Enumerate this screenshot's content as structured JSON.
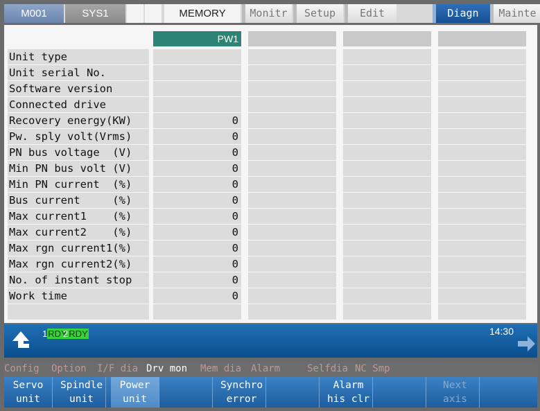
{
  "topbar": {
    "part_system": "M001",
    "system": "SYS1",
    "mode": "MEMORY",
    "tabs": [
      "Monitr",
      "Setup",
      "Edit",
      "Diagn",
      "Mainte"
    ],
    "active_tab": "Diagn"
  },
  "table": {
    "column_header": "PW1",
    "rows": [
      {
        "label": "Unit type",
        "value": ""
      },
      {
        "label": "Unit serial No.",
        "value": ""
      },
      {
        "label": "Software version",
        "value": ""
      },
      {
        "label": "Connected drive",
        "value": ""
      },
      {
        "label": "Recovery energy(KW)",
        "value": "0"
      },
      {
        "label": "Pw. sply volt(Vrms)",
        "value": "0"
      },
      {
        "label": "PN bus voltage  (V)",
        "value": "0"
      },
      {
        "label": "Min PN bus volt (V)",
        "value": "0"
      },
      {
        "label": "Min PN current  (%)",
        "value": "0"
      },
      {
        "label": "Bus current     (%)",
        "value": "0"
      },
      {
        "label": "Max current1    (%)",
        "value": "0"
      },
      {
        "label": "Max current2    (%)",
        "value": "0"
      },
      {
        "label": "Max rgn current1(%)",
        "value": "0"
      },
      {
        "label": "Max rgn current2(%)",
        "value": "0"
      },
      {
        "label": "No. of instant stop",
        "value": "0"
      },
      {
        "label": "Work time",
        "value": "0"
      },
      {
        "label": "",
        "value": ""
      }
    ]
  },
  "status": {
    "sys1_num": "1",
    "sys1_state": "RDY",
    "sys2_num": "2",
    "sys2_state": "RDY",
    "time": "14:30"
  },
  "menu": {
    "config": "Config",
    "option": "Option",
    "if_dia": "I/F dia",
    "drv_mon": "Drv mon",
    "mem_dia": "Mem dia",
    "alarm": "Alarm",
    "selfdia": "Selfdia",
    "nc_smp": "NC Smp"
  },
  "softkeys": {
    "servo": [
      "Servo",
      "unit"
    ],
    "spindle": [
      "Spindle",
      "unit"
    ],
    "power": [
      "Power",
      "unit"
    ],
    "synchro": [
      "Synchro",
      "error"
    ],
    "alarm_his": [
      "Alarm",
      "his clr"
    ],
    "next_axis": [
      "Next",
      "axis"
    ]
  },
  "colors": {
    "active_tab": "#1f5fa6",
    "column_header": "#2e8474",
    "ready": "#3ad23a",
    "status_bar": "#1563a8"
  }
}
